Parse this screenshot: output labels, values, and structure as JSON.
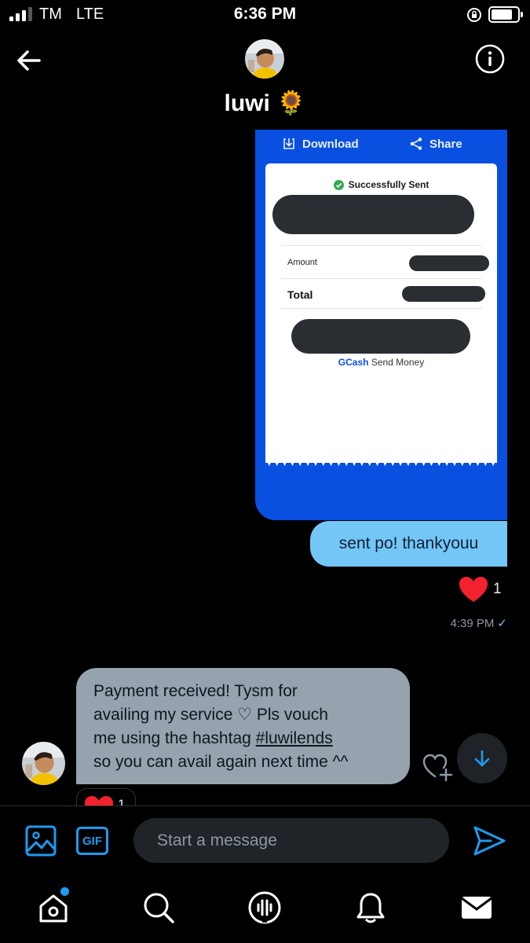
{
  "status_bar": {
    "carrier": "TM",
    "network": "LTE",
    "time": "6:36 PM",
    "signal_bars": 3,
    "battery_level": 0.8
  },
  "header": {
    "contact_name": "luwi 🌻",
    "back_icon": "arrow-left-icon",
    "info_icon": "info-circle-icon"
  },
  "card_message": {
    "download_label": "Download",
    "share_label": "Share",
    "receipt": {
      "status": "Successfully Sent",
      "amount_label": "Amount",
      "total_label": "Total",
      "footer_brand": "GCash",
      "footer_text": "Send Money"
    }
  },
  "sent_message": {
    "text": "sent po! thankyouu",
    "reaction_count": "1",
    "timestamp": "4:39 PM",
    "read_mark": "✓"
  },
  "incoming_message": {
    "line1": "Payment received! Tysm for",
    "line2": "availing my service ♡ Pls vouch",
    "line3_prefix": "me using the hashtag ",
    "hashtag": "#luwilends",
    "line4": "so you can avail again next time ^^",
    "reaction_count": "1"
  },
  "composer": {
    "placeholder": "Start a message",
    "gif_label": "GIF"
  },
  "bottom_nav": {
    "items": [
      "home-icon",
      "search-icon",
      "spaces-icon",
      "notifications-icon",
      "messages-icon"
    ]
  },
  "colors": {
    "accent": "#1d9bf0",
    "card_blue": "#0a50e0",
    "sent_bubble": "#74c6f7",
    "received_bubble": "#96a2ad",
    "heart": "#f4212e"
  }
}
